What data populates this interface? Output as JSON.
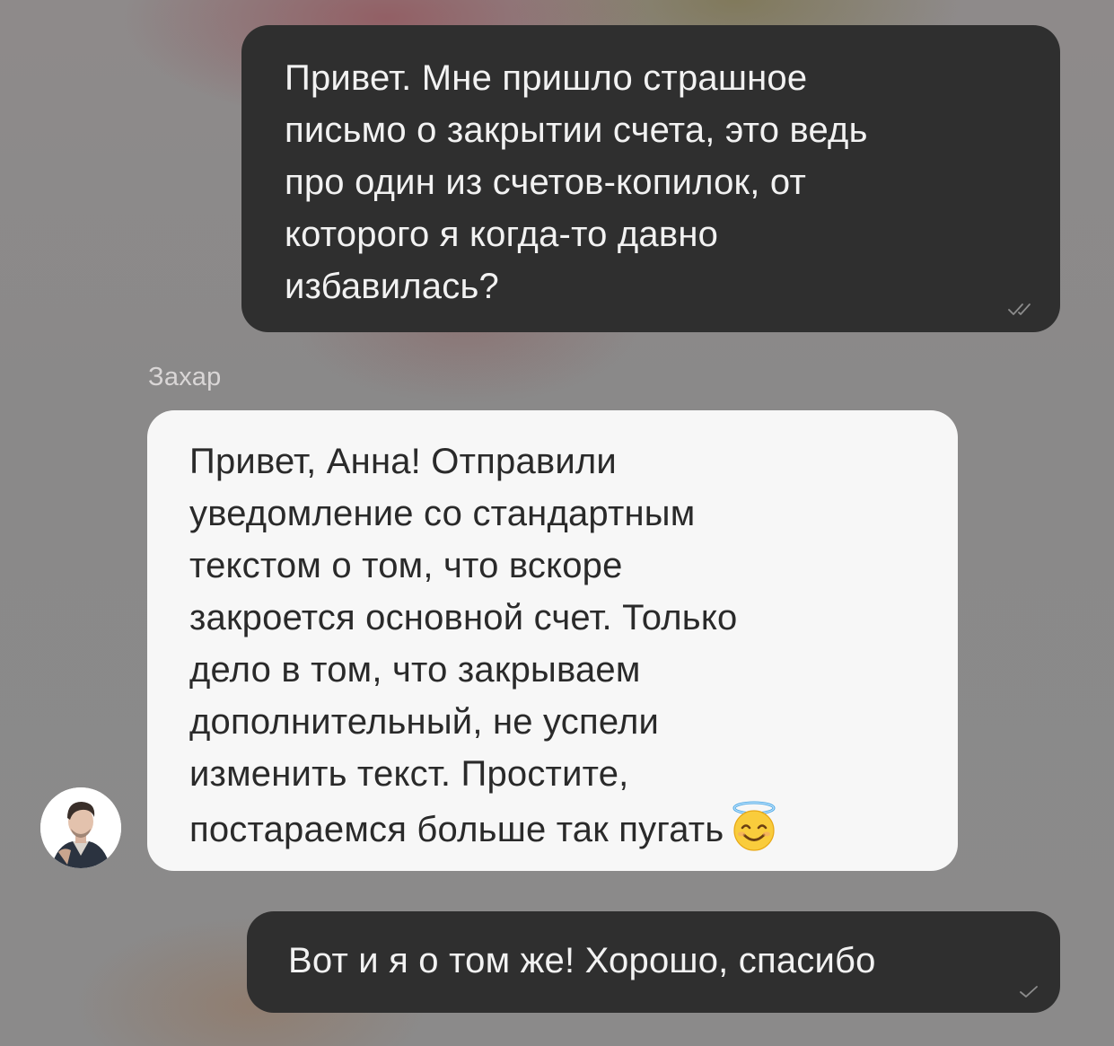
{
  "chat": {
    "messages": [
      {
        "direction": "outgoing",
        "text": "Привет. Мне пришло страшное\nписьмо о закрытии счета, это ведь\nпро один из счетов-копилок, от\nкоторого я когда-то давно\nизбавилась?",
        "status": "read",
        "status_icon": "double-check-icon"
      },
      {
        "direction": "incoming",
        "sender": "Захар",
        "text": "Привет, Анна! Отправили\nуведомление со стандартным\nтекстом о том, что вскоре\nзакроется основной счет. Только\nдело в том, что закрываем\nдополнительный, не успели\nизменить текст. Простите,\nпостараемся больше так пугать",
        "emoji": "smiling-face-with-halo-emoji",
        "avatar_icon": "user-avatar"
      },
      {
        "direction": "outgoing",
        "text": "Вот и я о том же! Хорошо, спасибо",
        "status": "sent",
        "status_icon": "single-check-icon"
      }
    ]
  },
  "colors": {
    "outgoing_bubble": "#2f2f2f",
    "incoming_bubble": "#f7f7f7",
    "sender_name": "#d9d6d6"
  }
}
